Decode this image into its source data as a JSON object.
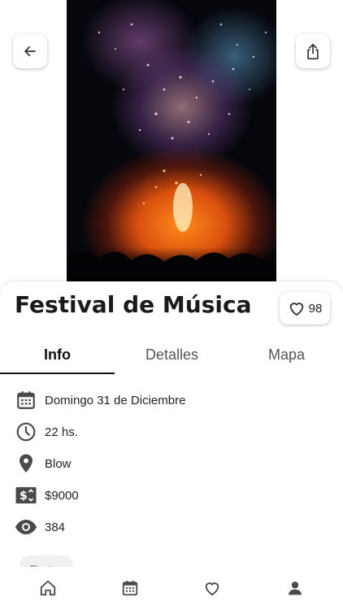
{
  "event": {
    "title": "Festival de Música",
    "likes": "98"
  },
  "tabs": [
    {
      "label": "Info",
      "active": true
    },
    {
      "label": "Detalles",
      "active": false
    },
    {
      "label": "Mapa",
      "active": false
    }
  ],
  "info": {
    "date": "Domingo 31 de Diciembre",
    "time": "22 hs.",
    "venue": "Blow",
    "price": "$9000",
    "views": "384"
  },
  "chip": {
    "label": "Fiesta"
  },
  "icons": {
    "back": "arrow-left-icon",
    "share": "share-icon",
    "like": "heart-outline-icon",
    "date": "calendar-icon",
    "time": "clock-icon",
    "venue": "location-pin-icon",
    "price": "price-tag-icon",
    "views": "eye-icon"
  },
  "nav": [
    "home-icon",
    "calendar-icon",
    "heart-icon",
    "person-icon"
  ],
  "colors": {
    "icon": "#4a4a4a",
    "text": "#1a1a1a",
    "indicator": "#111111"
  }
}
